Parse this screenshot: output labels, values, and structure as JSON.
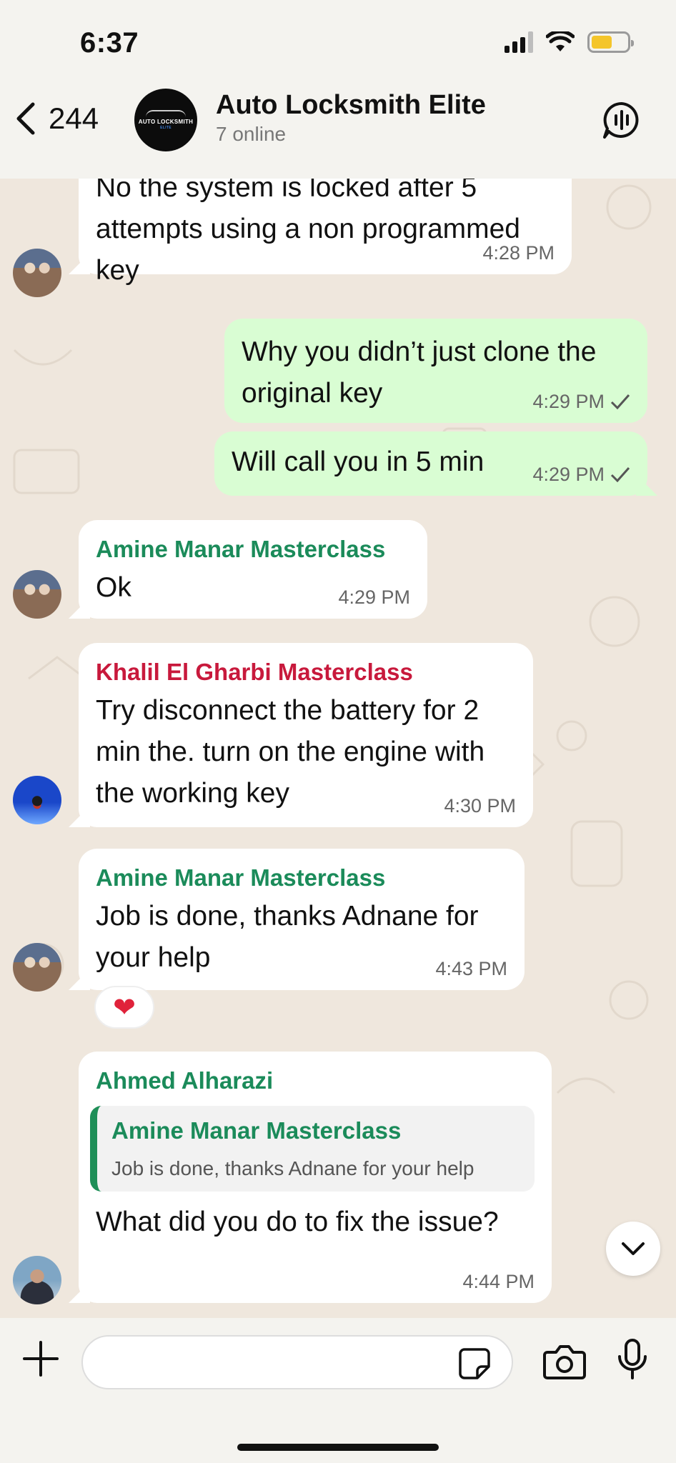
{
  "status_bar": {
    "time": "6:37"
  },
  "header": {
    "back_count": "244",
    "avatar_text": "AUTO LOCKSMITH",
    "avatar_subtext": "ELITE",
    "title": "Auto Locksmith Elite",
    "subtitle": "7 online"
  },
  "messages": [
    {
      "direction": "in",
      "text": "No the system is locked after 5 attempts using a non programmed key",
      "time": "4:28 PM"
    },
    {
      "direction": "out",
      "text": "Why you didn’t just clone the original key",
      "time": "4:29 PM"
    },
    {
      "direction": "out",
      "text": "Will call you in 5 min",
      "time": "4:29 PM"
    },
    {
      "direction": "in",
      "sender": "Amine Manar Masterclass",
      "sender_color": "#1b8b5a",
      "text": "Ok",
      "time": "4:29 PM"
    },
    {
      "direction": "in",
      "sender": "Khalil El Gharbi Masterclass",
      "sender_color": "#c8193c",
      "text": "Try disconnect the battery for 2 min the. turn on the engine with the working key",
      "time": "4:30 PM"
    },
    {
      "direction": "in",
      "sender": "Amine Manar Masterclass",
      "sender_color": "#1b8b5a",
      "text": "Job is done, thanks Adnane for your help",
      "time": "4:43 PM",
      "reaction": "❤"
    },
    {
      "direction": "in",
      "sender": "Ahmed Alharazi",
      "sender_color": "#1b8b5a",
      "quote_sender": "Amine Manar Masterclass",
      "quote_text": "Job is done, thanks Adnane for your help",
      "text": "What did you do to fix the issue?",
      "time": "4:44 PM"
    }
  ],
  "composer": {
    "placeholder": ""
  },
  "icons": {
    "back": "chevron-left-icon",
    "voice_chat": "voice-chat-icon",
    "scroll_down": "chevron-down-icon",
    "add": "plus-icon",
    "sticker": "sticker-icon",
    "camera": "camera-icon",
    "mic": "microphone-icon",
    "read": "checkmark-icon"
  },
  "colors": {
    "outgoing_bubble": "#d9fdd3",
    "incoming_bubble": "#ffffff",
    "wallpaper": "#efe7dd"
  }
}
